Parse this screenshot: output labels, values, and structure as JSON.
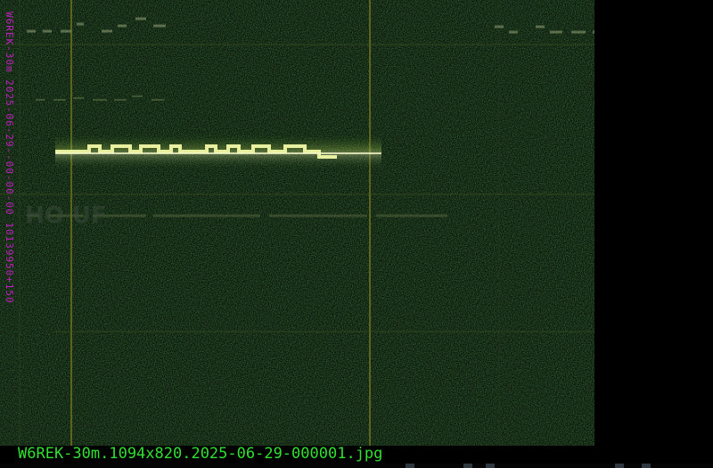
{
  "side_label": "W6REK-30m 2025-06-29--00-00-00 10139950+150",
  "caption": "W6REK-30m.1094x820.2025-06-29-000001.jpg",
  "colors": {
    "background": "#0a130a",
    "signal": "#e8f0a0",
    "label": "#c020c0",
    "caption": "#30e030",
    "grid": "#6a6a20"
  }
}
